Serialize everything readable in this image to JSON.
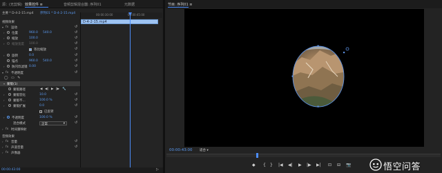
{
  "effect_controls": {
    "tabs": [
      {
        "label": "源：(无剪辑)",
        "active": false
      },
      {
        "label": "效果控件 ≡",
        "active": true
      },
      {
        "label": "音频剪辑混合器: 序列01",
        "active": false
      },
      {
        "label": "元数据",
        "active": false
      }
    ],
    "source_line": "主要 * D-4-2-15.mp4",
    "sequence_line": "序列01 * D-4-2-15.mp4",
    "sections": {
      "video_effects": "视频效果",
      "motion": "运动",
      "position_label": "位置",
      "position_x": "960.0",
      "position_y": "540.0",
      "scale_label": "缩放",
      "scale_value": "100.0",
      "scale_width_label": "缩放宽度",
      "scale_width_value": "100.0",
      "uniform_scale": "等比缩放",
      "rotation_label": "旋转",
      "rotation_value": "0.0",
      "anchor_label": "锚点",
      "anchor_x": "960.0",
      "anchor_y": "540.0",
      "flicker_label": "防闪烁滤镜",
      "flicker_value": "0.00",
      "opacity_section": "不透明度",
      "mask_label": "蒙版(1)",
      "mask_path_label": "蒙版路径",
      "mask_feather_label": "蒙版羽化",
      "mask_feather_value": "10.0",
      "mask_opacity_label": "蒙版不...",
      "mask_opacity_value": "100.0 %",
      "mask_expansion_label": "蒙版扩展",
      "mask_expansion_value": "0.0",
      "inverted_label": "已反转",
      "opacity_label": "不透明度",
      "opacity_value": "100.0 %",
      "blend_label": "混合模式",
      "blend_value": "正常",
      "time_remap": "时间重映射",
      "audio_effects": "音频效果",
      "volume": "音量",
      "channel_volume": "声道音量",
      "panner": "声像器"
    },
    "timeline": {
      "t0": "00:00:30:00",
      "t1": "00:00:45:00",
      "clip_label": "D-4-2-15.mp4"
    },
    "bottom_time": "00:00:43:00"
  },
  "program_monitor": {
    "title": "节目: 序列01 ≡",
    "timecode": "00:00:43:00",
    "fit_label": "适合",
    "controls": [
      "◆",
      "{",
      "}",
      "|◀",
      "◀|",
      "▶",
      "|▶",
      "▶|",
      "⊡",
      "⊟",
      "📷"
    ],
    "plus": "+"
  },
  "watermark": {
    "text": "悟空问答"
  },
  "colors": {
    "accent": "#4c8dfa",
    "value_blue": "#5b9bf3",
    "panel": "#232323",
    "clip": "#9fc4f2"
  }
}
